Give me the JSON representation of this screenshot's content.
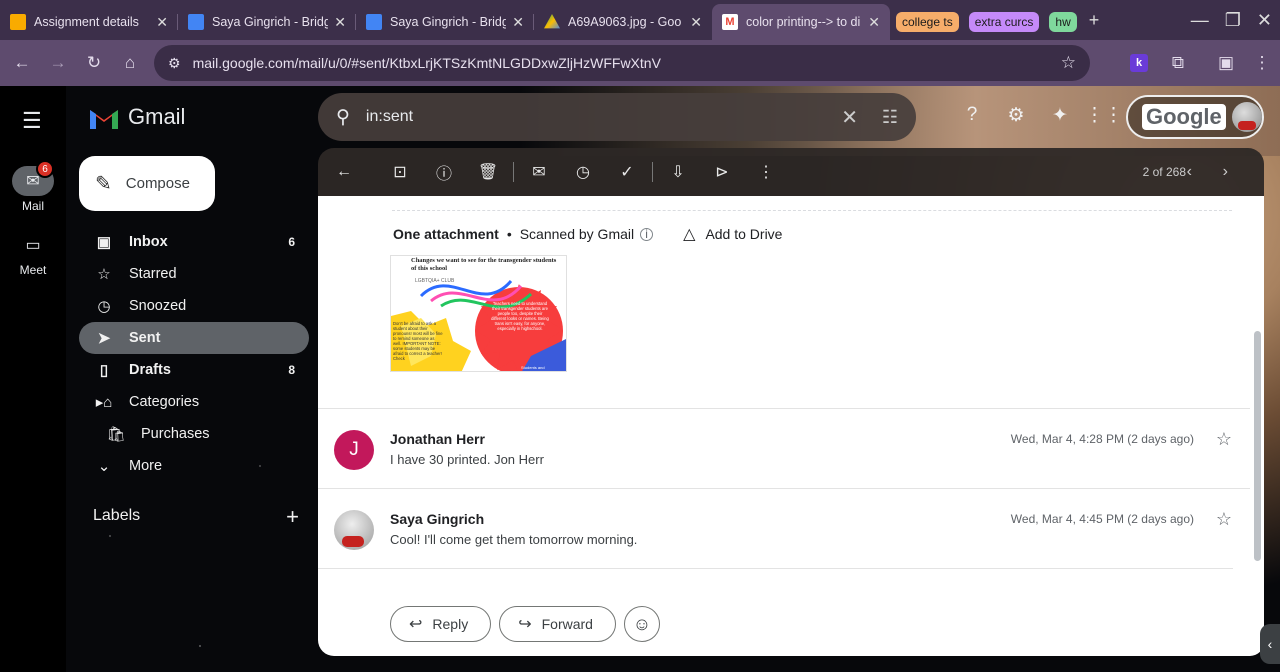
{
  "browser": {
    "tabs": [
      {
        "title": "Assignment details",
        "favicon_color": "#f9ab00"
      },
      {
        "title": "Saya Gingrich - Bridg",
        "favicon_color": "#4285f4"
      },
      {
        "title": "Saya Gingrich - Bridg",
        "favicon_color": "#4285f4"
      },
      {
        "title": "A69A9063.jpg - Goo",
        "favicon_color": "#34a853"
      },
      {
        "title": "color printing--> to di",
        "favicon_color": "#ea4335"
      }
    ],
    "tab_groups": [
      {
        "label": "college ts",
        "color": "#f6ad6a"
      },
      {
        "label": "extra curcs",
        "color": "#c58af9"
      },
      {
        "label": "hw",
        "color": "#7fd89c"
      }
    ],
    "url": "mail.google.com/mail/u/0/#sent/KtbxLrjKTSzKmtNLGDDxwZljHzWFFwXtnV",
    "extension_label": "k"
  },
  "rail": {
    "mail_label": "Mail",
    "mail_badge": "6",
    "meet_label": "Meet"
  },
  "app": {
    "name": "Gmail"
  },
  "search": {
    "value": "in:sent"
  },
  "account": {
    "label": "Google"
  },
  "compose": {
    "label": "Compose"
  },
  "nav": [
    {
      "label": "Inbox",
      "count": "6",
      "icon": "inbox-icon"
    },
    {
      "label": "Starred",
      "count": "",
      "icon": "star-icon"
    },
    {
      "label": "Snoozed",
      "count": "",
      "icon": "clock-icon"
    },
    {
      "label": "Sent",
      "count": "",
      "icon": "send-icon"
    },
    {
      "label": "Drafts",
      "count": "8",
      "icon": "file-icon"
    },
    {
      "label": "Categories",
      "count": "",
      "icon": "label-icon"
    },
    {
      "label": "Purchases",
      "count": "",
      "icon": "bag-icon"
    },
    {
      "label": "More",
      "count": "",
      "icon": "chevron-down-icon"
    }
  ],
  "labels": {
    "heading": "Labels"
  },
  "toolbar": {
    "pager": "2 of 268"
  },
  "thread": {
    "attachment_heading": "One attachment",
    "scanned": "Scanned by Gmail",
    "add_to_drive": "Add to Drive",
    "poster": {
      "title": "Changes we want to see for the transgender students of this school",
      "club": "LGBTQIA+ CLUB",
      "left_text": "Don't be afraid to ask a student about their pronouns! most will be fine to remind someone as well. IMPORTANT NOTE: some students may be afraid to correct a teacher! Check",
      "right_text": "Teachers need to understand their transgender students are people too, despite their different looks or names. Being trans isn't easy, for anyone, especially in highschool.",
      "corner_text": "Students and"
    },
    "messages": [
      {
        "sender": "Jonathan Herr",
        "initial": "J",
        "snippet": "I have 30 printed. Jon Herr",
        "date": "Wed, Mar 4, 4:28 PM (2 days ago)",
        "avatar_color": "#c2185b"
      },
      {
        "sender": "Saya Gingrich",
        "initial": "",
        "snippet": "Cool! I'll come get them tomorrow morning.",
        "date": "Wed, Mar 4, 4:45 PM (2 days ago)",
        "avatar_color": "#bdbdbd"
      }
    ],
    "reply_label": "Reply",
    "forward_label": "Forward"
  }
}
